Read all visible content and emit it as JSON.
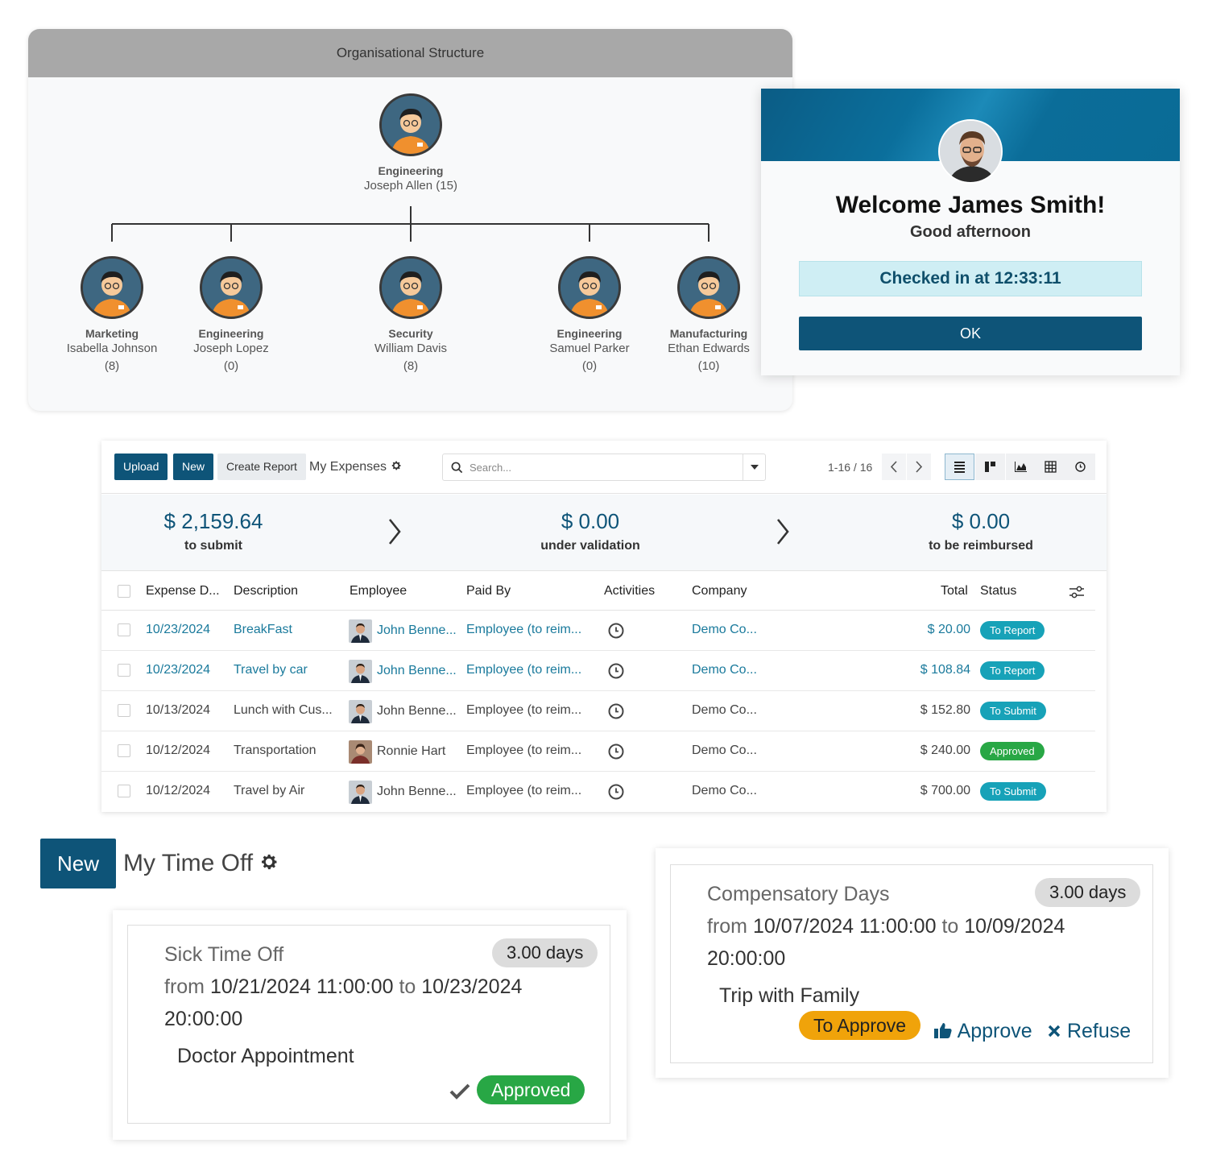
{
  "org": {
    "title": "Organisational Structure",
    "root": {
      "dept": "Engineering",
      "name": "Joseph Allen (15)"
    },
    "children": [
      {
        "dept": "Marketing",
        "name": "Isabella Johnson",
        "count": "(8)"
      },
      {
        "dept": "Engineering",
        "name": "Joseph Lopez",
        "count": "(0)"
      },
      {
        "dept": "Security",
        "name": "William Davis",
        "count": "(8)"
      },
      {
        "dept": "Engineering",
        "name": "Samuel Parker",
        "count": "(0)"
      },
      {
        "dept": "Manufacturing",
        "name": "Ethan Edwards",
        "count": "(10)"
      }
    ]
  },
  "welcome": {
    "title": "Welcome James Smith!",
    "subtitle": "Good afternoon",
    "checked_label": "Checked in at",
    "checked_time": "12:33:11",
    "ok_label": "OK"
  },
  "expenses": {
    "toolbar": {
      "upload": "Upload",
      "new": "New",
      "create_report": "Create Report",
      "view_title": "My Expenses",
      "search_placeholder": "Search...",
      "pager": "1-16 / 16"
    },
    "summary": [
      {
        "amount": "$ 2,159.64",
        "label": "to submit"
      },
      {
        "amount": "$ 0.00",
        "label": "under validation"
      },
      {
        "amount": "$ 0.00",
        "label": "to be reimbursed"
      }
    ],
    "columns": [
      "Expense D...",
      "Description",
      "Employee",
      "Paid By",
      "Activities",
      "Company",
      "Total",
      "Status"
    ],
    "rows": [
      {
        "date": "10/23/2024",
        "desc": "BreakFast",
        "employee": "John Benne...",
        "paid_by": "Employee (to reim...",
        "company": "Demo Co...",
        "total": "$ 20.00",
        "status": "To Report"
      },
      {
        "date": "10/23/2024",
        "desc": "Travel by car",
        "employee": "John Benne...",
        "paid_by": "Employee (to reim...",
        "company": "Demo Co...",
        "total": "$ 108.84",
        "status": "To Report"
      },
      {
        "date": "10/13/2024",
        "desc": "Lunch with Cus...",
        "employee": "John Benne...",
        "paid_by": "Employee (to reim...",
        "company": "Demo Co...",
        "total": "$ 152.80",
        "status": "To Submit"
      },
      {
        "date": "10/12/2024",
        "desc": "Transportation",
        "employee": "Ronnie Hart",
        "paid_by": "Employee (to reim...",
        "company": "Demo Co...",
        "total": "$ 240.00",
        "status": "Approved"
      },
      {
        "date": "10/12/2024",
        "desc": "Travel by Air",
        "employee": "John Benne...",
        "paid_by": "Employee (to reim...",
        "company": "Demo Co...",
        "total": "$ 700.00",
        "status": "To Submit"
      }
    ]
  },
  "timeoff": {
    "new_label": "New",
    "title": "My Time Off",
    "cards": [
      {
        "type": "Sick Time Off",
        "days": "3.00 days",
        "from_word": "from",
        "from": "10/21/2024 11:00:00",
        "to_word": "to",
        "to_date": "10/23/2024",
        "to_time": "20:00:00",
        "desc": "Doctor Appointment",
        "status": "Approved"
      },
      {
        "type": "Compensatory Days",
        "days": "3.00 days",
        "from_word": "from",
        "from": "10/07/2024 11:00:00",
        "to_word": "to",
        "to_date": "10/09/2024",
        "to_time": "20:00:00",
        "desc": "Trip with Family",
        "status": "To Approve",
        "approve": "Approve",
        "refuse": "Refuse"
      }
    ]
  },
  "colors": {
    "primary": "#0e5478",
    "link": "#1a7a9c",
    "info": "#17a2b8",
    "success": "#28a745",
    "warning": "#f0a30a"
  }
}
